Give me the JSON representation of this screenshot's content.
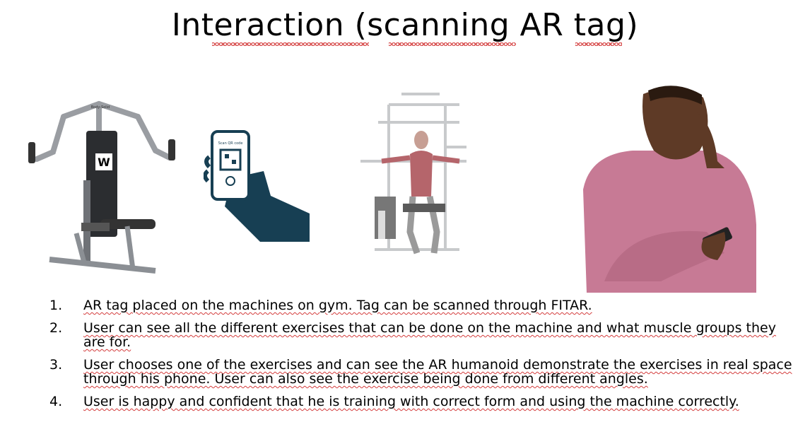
{
  "slide": {
    "title": "Interaction (scanning AR tag)",
    "images": {
      "chest_press_machine": {
        "tag_label": "W",
        "brand_text": "Body-Solid"
      },
      "hand_phone": {
        "screen_text": "Scan QR code"
      },
      "pec_deck_figure": {},
      "man_phone": {}
    },
    "steps": [
      {
        "number": "1.",
        "text": "AR tag placed on the machines on gym. Tag can be scanned through FITAR."
      },
      {
        "number": "2.",
        "text": "User can see all the different exercises that can be done on the machine and what muscle groups they are for."
      },
      {
        "number": "3.",
        "text": "User chooses one of the exercises and can see the AR humanoid demonstrate the exercises in real space through his phone. User can also see the exercise being done from different angles."
      },
      {
        "number": "4.",
        "text": "User is happy and confident that he is training with correct form and using the machine correctly."
      }
    ]
  }
}
